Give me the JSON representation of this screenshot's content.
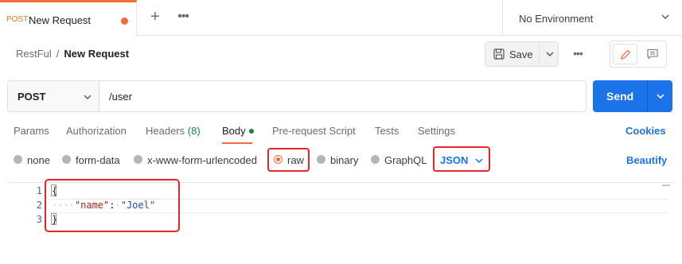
{
  "tab": {
    "method": "POST",
    "title": "New Request"
  },
  "environment": {
    "label": "No Environment"
  },
  "breadcrumb": {
    "collection": "RestFul",
    "separator": "/",
    "request": "New Request"
  },
  "toolbar": {
    "save_label": "Save"
  },
  "request": {
    "method": "POST",
    "url": "/user",
    "send_label": "Send"
  },
  "tabs": [
    {
      "label": "Params"
    },
    {
      "label": "Authorization"
    },
    {
      "label": "Headers",
      "count": "(8)"
    },
    {
      "label": "Body",
      "active": true
    },
    {
      "label": "Pre-request Script"
    },
    {
      "label": "Tests"
    },
    {
      "label": "Settings"
    }
  ],
  "cookies_label": "Cookies",
  "body_types": [
    {
      "label": "none"
    },
    {
      "label": "form-data"
    },
    {
      "label": "x-www-form-urlencoded"
    },
    {
      "label": "raw",
      "selected": true
    },
    {
      "label": "binary"
    },
    {
      "label": "GraphQL"
    }
  ],
  "language": "JSON",
  "beautify_label": "Beautify",
  "editor": {
    "line_numbers": [
      "1",
      "2",
      "3"
    ],
    "lines": {
      "open": "{",
      "indent": "····",
      "key": "\"name\"",
      "colon": ":",
      "space": "·",
      "value": "\"Joel\"",
      "close": "}"
    }
  },
  "colors": {
    "accent": "#f26b3a",
    "primary": "#1a73e8",
    "highlight": "#e5252a",
    "success": "#0d8a3a"
  }
}
